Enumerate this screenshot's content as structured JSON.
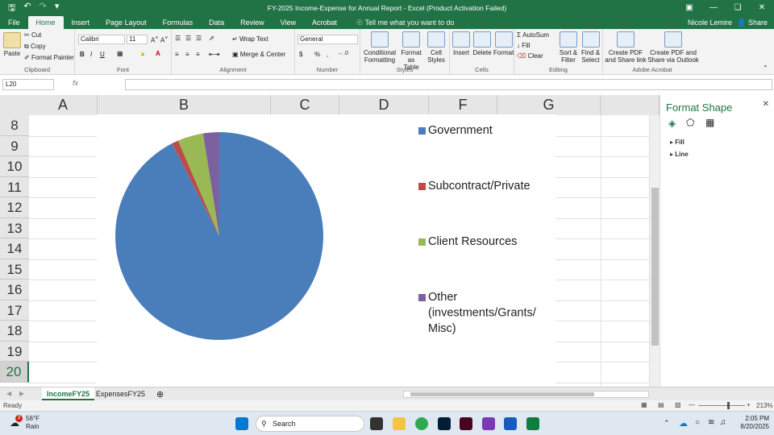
{
  "window": {
    "title": "FY-2025 Income-Expense for Annual Report  -  Excel (Product Activation Failed)",
    "user": "Nicole Lemire",
    "share": "Share"
  },
  "menu_tabs": [
    "File",
    "Home",
    "Insert",
    "Page Layout",
    "Formulas",
    "Data",
    "Review",
    "View",
    "Acrobat"
  ],
  "tell_me": "Tell me what you want to do",
  "ribbon": {
    "clipboard": {
      "paste": "Paste",
      "cut": "Cut",
      "copy": "Copy",
      "format_painter": "Format Painter",
      "label": "Clipboard"
    },
    "font": {
      "name": "Calibri",
      "size": "11",
      "label": "Font"
    },
    "alignment": {
      "wrap": "Wrap Text",
      "merge": "Merge & Center",
      "label": "Alignment"
    },
    "number": {
      "format": "General",
      "currency": "$",
      "percent": "%",
      "comma": ",",
      "label": "Number"
    },
    "styles": {
      "conditional": "Conditional",
      "conditional2": "Formatting",
      "format_table": "Format as",
      "format_table2": "Table",
      "cell_styles": "Cell",
      "cell_styles2": "Styles",
      "label": "Styles"
    },
    "cells": {
      "insert": "Insert",
      "delete": "Delete",
      "format": "Format",
      "label": "Cells"
    },
    "editing": {
      "autosum": "AutoSum",
      "fill": "Fill",
      "clear": "Clear",
      "sort": "Sort &",
      "sort2": "Filter",
      "find": "Find &",
      "find2": "Select",
      "label": "Editing"
    },
    "acrobat": {
      "pdf": "Create PDF",
      "pdf2": "and Share link",
      "pdf_outlook": "Create PDF and",
      "pdf_outlook2": "Share via Outlook",
      "label": "Adobe Acrobat"
    }
  },
  "formula_bar": {
    "name_box": "L20",
    "fx": "fx",
    "value": ""
  },
  "columns": [
    "A",
    "B",
    "C",
    "D",
    "F",
    "G"
  ],
  "rows": [
    "8",
    "9",
    "10",
    "11",
    "12",
    "13",
    "14",
    "15",
    "16",
    "17",
    "18",
    "19",
    "20"
  ],
  "selected_row": "20",
  "chart_data": {
    "type": "pie",
    "title": "",
    "categories": [
      "Government",
      "Subcontract/Private",
      "Client Resources",
      "Other"
    ],
    "legend_lines": [
      [
        "Government"
      ],
      [
        "Subcontract/Private"
      ],
      [
        "Client Resources"
      ],
      [
        "Other",
        "(investments/Grants/",
        "Misc)"
      ]
    ],
    "values": [
      92.5,
      1.0,
      4.0,
      2.5
    ],
    "colors": [
      "#4a7ebb",
      "#be4b48",
      "#98b954",
      "#7d60a0"
    ],
    "legend_position": "right"
  },
  "format_pane": {
    "title": "Format Shape",
    "fill": "Fill",
    "line": "Line"
  },
  "sheets": [
    "IncomeFY25",
    "ExpensesFY25"
  ],
  "status": {
    "ready": "Ready",
    "zoom": "213%"
  },
  "taskbar": {
    "weather_temp": "56°F",
    "weather_desc": "Rain",
    "weather_badge": "3",
    "search": "Search",
    "time": "2:05 PM",
    "date": "8/20/2025"
  }
}
